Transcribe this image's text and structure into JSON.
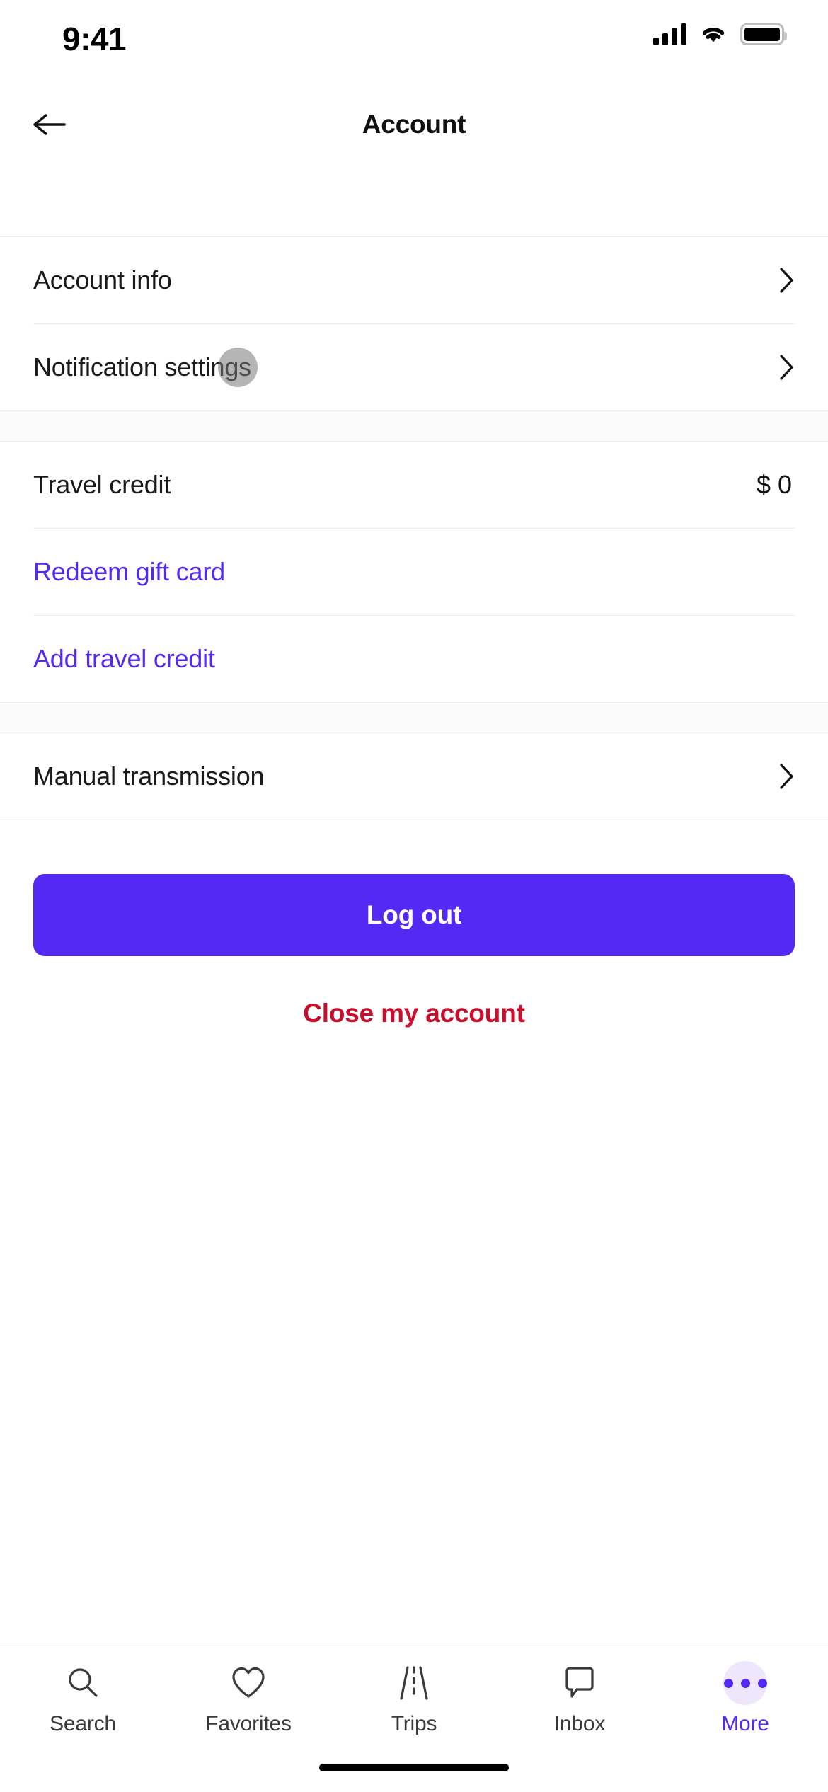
{
  "status_bar": {
    "time": "9:41",
    "icons": [
      "cellular-signal-icon",
      "wifi-icon",
      "battery-icon"
    ]
  },
  "header": {
    "title": "Account",
    "back_icon": "arrow-left-icon"
  },
  "colors": {
    "accent_purple": "#5429F4",
    "accent_purple_soft": "#EEE7FC",
    "danger_red": "#C8102E",
    "text_primary": "#1A1A1A",
    "divider": "#EAEAEA",
    "background": "#FFFFFF",
    "section_gap": "#FBFBFB",
    "touch_indicator": "rgba(120,120,120,0.55)"
  },
  "sections": [
    {
      "name": "account-section",
      "rows": [
        {
          "label": "Account info",
          "type": "disclosure",
          "chevron": "chevron-right-icon"
        },
        {
          "label": "Notification settings",
          "type": "disclosure",
          "chevron": "chevron-right-icon",
          "touched": true
        }
      ]
    },
    {
      "name": "credit-section",
      "rows": [
        {
          "label": "Travel credit",
          "type": "value",
          "value": "$ 0"
        },
        {
          "label": "Redeem gift card",
          "type": "link"
        },
        {
          "label": "Add travel credit",
          "type": "link"
        }
      ]
    },
    {
      "name": "vehicle-section",
      "rows": [
        {
          "label": "Manual transmission",
          "type": "disclosure",
          "chevron": "chevron-right-icon"
        }
      ]
    }
  ],
  "actions": {
    "logout_label": "Log out",
    "close_account_label": "Close my account"
  },
  "tabbar": {
    "items": [
      {
        "label": "Search",
        "icon": "magnifier-icon",
        "active": false
      },
      {
        "label": "Favorites",
        "icon": "heart-icon",
        "active": false
      },
      {
        "label": "Trips",
        "icon": "road-icon",
        "active": false
      },
      {
        "label": "Inbox",
        "icon": "chat-bubble-icon",
        "active": false
      },
      {
        "label": "More",
        "icon": "ellipsis-icon",
        "active": true
      }
    ]
  }
}
